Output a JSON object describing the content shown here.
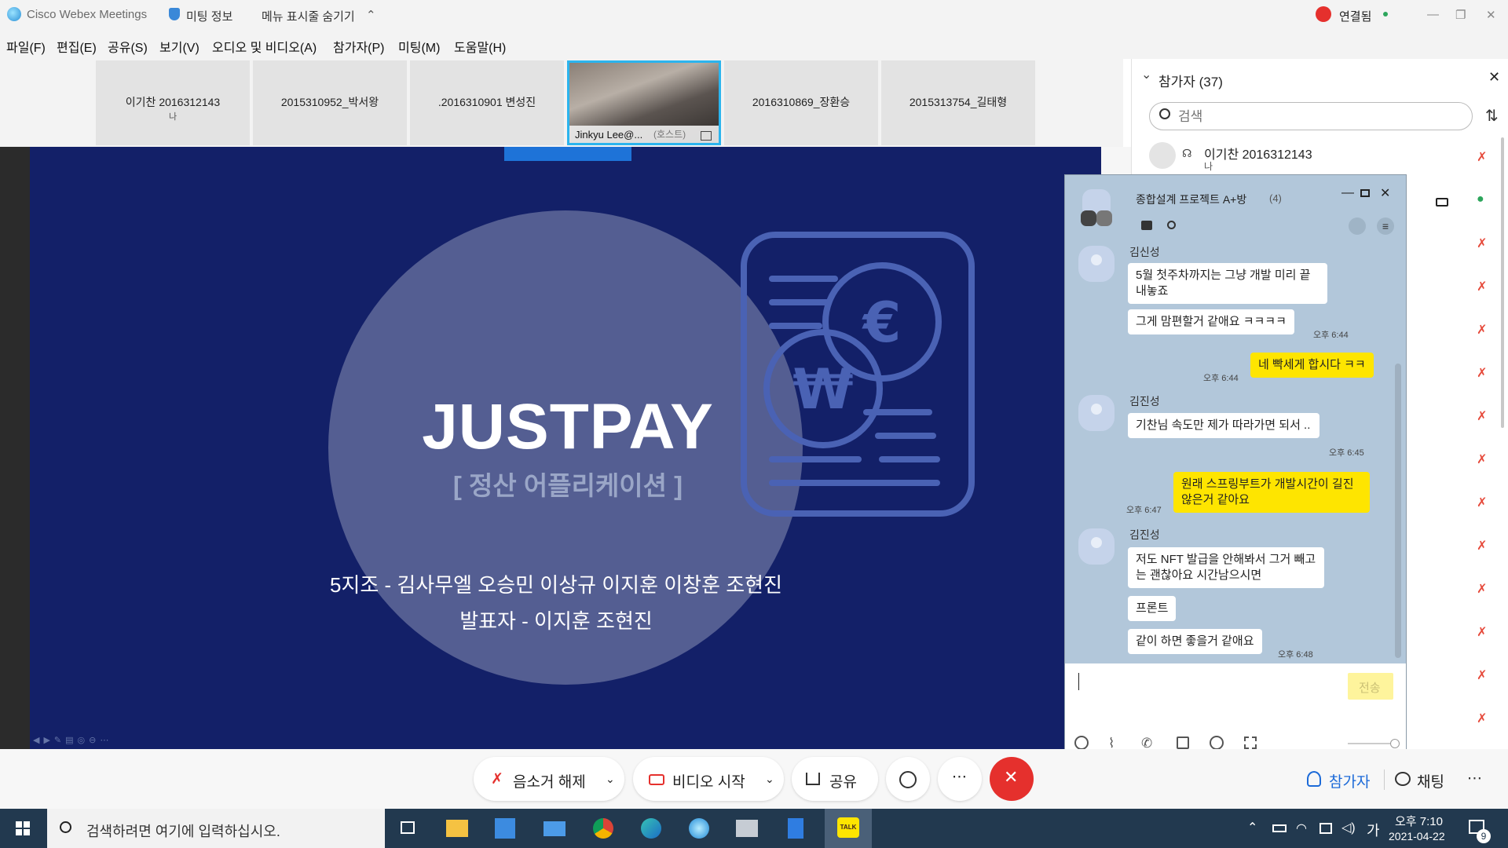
{
  "titlebar": {
    "app": "Cisco Webex Meetings",
    "meeting_info": "미팅 정보",
    "hide_menu": "메뉴 표시줄 숨기기",
    "status": "연결됨"
  },
  "menu": [
    "파일(F)",
    "편집(E)",
    "공유(S)",
    "보기(V)",
    "오디오 및 비디오(A)",
    "참가자(P)",
    "미팅(M)",
    "도움말(H)"
  ],
  "tiles": [
    {
      "name": "이기찬 2016312143",
      "sub": "나"
    },
    {
      "name": "2015310952_박서왕",
      "sub": ""
    },
    {
      "name": ".2016310901 변성진",
      "sub": ""
    },
    {
      "name": "Jinkyu Lee@...",
      "sub": "(호스트)"
    },
    {
      "name": "2016310869_장환승",
      "sub": ""
    },
    {
      "name": "2015313754_길태형",
      "sub": ""
    }
  ],
  "slide": {
    "title": "JUSTPAY",
    "subtitle": "[ 정산 어플리케이션 ]",
    "team": "5지조 -  김사무엘 오승민 이상규 이지훈 이창훈 조현진",
    "presenters": "발표자 - 이지훈 조현진",
    "accent": "#132068"
  },
  "panel": {
    "title": "참가자 (37)",
    "search_placeholder": "검색",
    "first_name": "이기찬 2016312143",
    "first_sub": "나"
  },
  "chat": {
    "title": "종합설계 프로젝트 A+방",
    "count": "(4)",
    "messages": [
      {
        "who": "김신성",
        "text": "5월 첫주차까지는 그냥 개발 미리 끝내놓죠",
        "time": "",
        "mine": false
      },
      {
        "who": "",
        "text": "그게 맘편할거 같애요 ㅋㅋㅋㅋ",
        "time": "오후 6:44",
        "mine": false
      },
      {
        "who": "",
        "text": "네 빡세게 합시다 ㅋㅋ",
        "time": "오후 6:44",
        "mine": true
      },
      {
        "who": "김진성",
        "text": "기찬님 속도만 제가 따라가면 되서 ..",
        "time": "오후 6:45",
        "mine": false
      },
      {
        "who": "",
        "text": "원래 스프링부트가 개발시간이 길진 않은거 같아요",
        "time": "오후 6:47",
        "mine": true
      },
      {
        "who": "김진성",
        "text": "저도 NFT 발급을 안해봐서 그거 빼고는 괜찮아요 시간남으시면",
        "time": "",
        "mine": false
      },
      {
        "who": "",
        "text": "프론트",
        "time": "",
        "mine": false
      },
      {
        "who": "",
        "text": "같이 하면 좋을거 같애요",
        "time": "오후 6:48",
        "mine": false
      }
    ],
    "send": "전송"
  },
  "controls": {
    "mute": "음소거 해제",
    "video": "비디오 시작",
    "share": "공유",
    "participants": "참가자",
    "chat": "채팅",
    "end_color": "#e5302d"
  },
  "taskbar": {
    "search": "검색하려면 여기에 입력하십시오.",
    "ime": "가",
    "time": "오후 7:10",
    "date": "2021-04-22",
    "notif": "9"
  }
}
